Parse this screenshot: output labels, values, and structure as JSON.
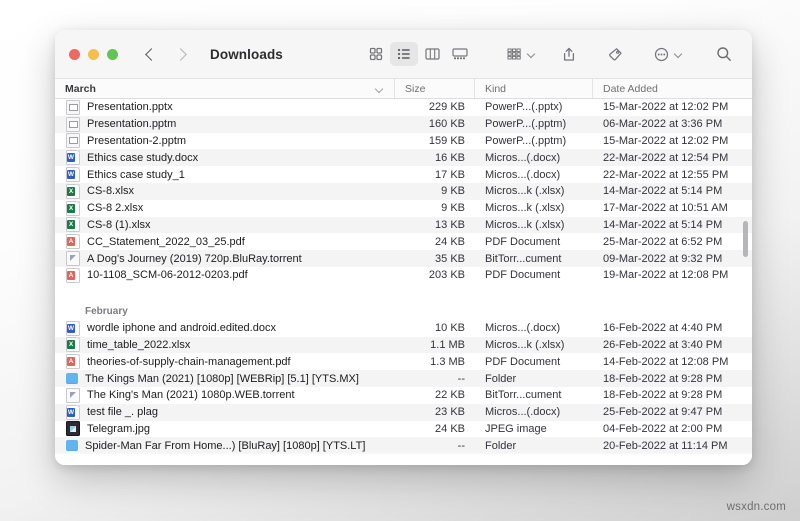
{
  "window": {
    "title": "Downloads",
    "traffic_lights": [
      "close",
      "minimize",
      "zoom"
    ],
    "back_label": "Back",
    "forward_label": "Forward"
  },
  "toolbar": {
    "icon_view": "grid-view-icon",
    "list_view": "list-view-icon",
    "column_view": "column-view-icon",
    "gallery_view": "gallery-view-icon",
    "group_by": "group-by-icon",
    "share": "share-icon",
    "tags": "tag-icon",
    "more": "more-actions-icon",
    "search": "search-icon"
  },
  "columns": {
    "name": "March",
    "size": "Size",
    "kind": "Kind",
    "date": "Date Added"
  },
  "groups": [
    {
      "label": "March",
      "is_header_row": false,
      "files": [
        {
          "name": "Presentation.pptx",
          "icon": "ppt",
          "size": "229 KB",
          "kind": "PowerP...(.pptx)",
          "date": "15-Mar-2022 at 12:02 PM"
        },
        {
          "name": "Presentation.pptm",
          "icon": "ppt",
          "size": "160 KB",
          "kind": "PowerP...(.pptm)",
          "date": "06-Mar-2022 at 3:36 PM"
        },
        {
          "name": "Presentation-2.pptm",
          "icon": "ppt",
          "size": "159 KB",
          "kind": "PowerP...(.pptm)",
          "date": "15-Mar-2022 at 12:02 PM"
        },
        {
          "name": "Ethics case study.docx",
          "icon": "word",
          "size": "16 KB",
          "kind": "Micros...(.docx)",
          "date": "22-Mar-2022 at 12:54 PM"
        },
        {
          "name": "Ethics case study_1",
          "icon": "word",
          "size": "17 KB",
          "kind": "Micros...(.docx)",
          "date": "22-Mar-2022 at 12:55 PM"
        },
        {
          "name": "CS-8.xlsx",
          "icon": "excel",
          "size": "9 KB",
          "kind": "Micros...k (.xlsx)",
          "date": "14-Mar-2022 at 5:14 PM"
        },
        {
          "name": "CS-8 2.xlsx",
          "icon": "excel",
          "size": "9 KB",
          "kind": "Micros...k (.xlsx)",
          "date": "17-Mar-2022 at 10:51 AM"
        },
        {
          "name": "CS-8 (1).xlsx",
          "icon": "excel",
          "size": "13 KB",
          "kind": "Micros...k (.xlsx)",
          "date": "14-Mar-2022 at 5:14 PM"
        },
        {
          "name": "CC_Statement_2022_03_25.pdf",
          "icon": "pdf",
          "size": "24 KB",
          "kind": "PDF Document",
          "date": "25-Mar-2022 at 6:52 PM"
        },
        {
          "name": "A Dog's Journey (2019) 720p.BluRay.torrent",
          "icon": "torrent",
          "size": "35 KB",
          "kind": "BitTorr...cument",
          "date": "09-Mar-2022 at 9:32 PM"
        },
        {
          "name": "10-1108_SCM-06-2012-0203.pdf",
          "icon": "pdf",
          "size": "203 KB",
          "kind": "PDF Document",
          "date": "19-Mar-2022 at 12:08 PM"
        }
      ]
    },
    {
      "label": "February",
      "is_header_row": true,
      "files": [
        {
          "name": "wordle iphone and android.edited.docx",
          "icon": "word",
          "size": "10 KB",
          "kind": "Micros...(.docx)",
          "date": "16-Feb-2022 at 4:40 PM"
        },
        {
          "name": "time_table_2022.xlsx",
          "icon": "excel",
          "size": "1.1 MB",
          "kind": "Micros...k (.xlsx)",
          "date": "26-Feb-2022 at 3:40 PM"
        },
        {
          "name": "theories-of-supply-chain-management.pdf",
          "icon": "pdf",
          "size": "1.3 MB",
          "kind": "PDF Document",
          "date": "14-Feb-2022 at 12:08 PM"
        },
        {
          "name": "The Kings Man (2021) [1080p] [WEBRip] [5.1] [YTS.MX]",
          "icon": "folder",
          "size": "--",
          "kind": "Folder",
          "date": "18-Feb-2022 at 9:28 PM"
        },
        {
          "name": "The King's Man (2021) 1080p.WEB.torrent",
          "icon": "torrent",
          "size": "22 KB",
          "kind": "BitTorr...cument",
          "date": "18-Feb-2022 at 9:28 PM"
        },
        {
          "name": "test file _. plag",
          "icon": "word",
          "size": "23 KB",
          "kind": "Micros...(.docx)",
          "date": "25-Feb-2022 at 9:47 PM"
        },
        {
          "name": "Telegram.jpg",
          "icon": "image",
          "size": "24 KB",
          "kind": "JPEG image",
          "date": "04-Feb-2022 at 2:00 PM"
        },
        {
          "name": "Spider-Man Far From Home...) [BluRay] [1080p] [YTS.LT]",
          "icon": "folder",
          "size": "--",
          "kind": "Folder",
          "date": "20-Feb-2022 at 11:14 PM"
        }
      ]
    }
  ],
  "scrollbar": {
    "thumb_top_pct": 33,
    "thumb_height_pct": 10
  },
  "watermark": "wsxdn.com"
}
